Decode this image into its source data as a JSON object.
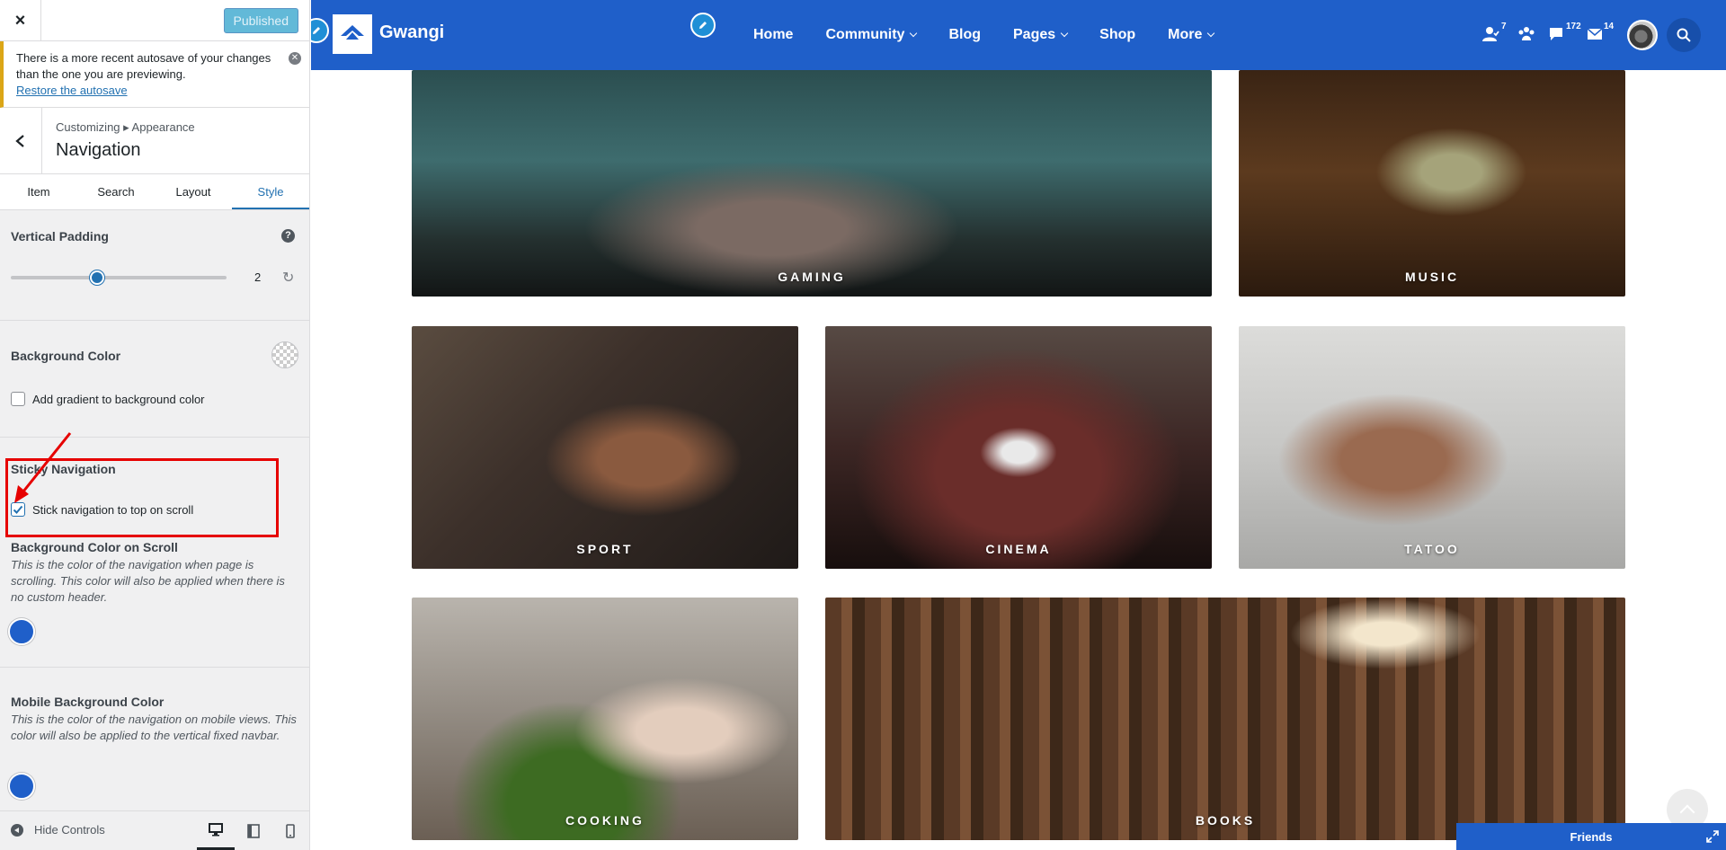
{
  "customizer": {
    "close_label": "×",
    "publish_label": "Published",
    "autosave": {
      "message": "There is a more recent autosave of your changes than the one you are previewing.",
      "link": "Restore the autosave"
    },
    "breadcrumb": "Customizing ▸ Appearance",
    "section_title": "Navigation",
    "tabs": [
      "Item",
      "Search",
      "Layout",
      "Style"
    ],
    "active_tab": "Style",
    "vertical_padding": {
      "label": "Vertical Padding",
      "help": "?",
      "value": "2",
      "slider_fraction": 0.4
    },
    "background_color": {
      "label": "Background Color",
      "gradient_checkbox": "Add gradient to background color",
      "gradient_checked": false
    },
    "sticky": {
      "label": "Sticky Navigation",
      "checkbox": "Stick navigation to top on scroll",
      "checked": true
    },
    "bg_on_scroll": {
      "label": "Background Color on Scroll",
      "description": "This is the color of the navigation when page is scrolling. This color will also be applied when there is no custom header.",
      "color": "#1f5fc9"
    },
    "mobile_bg": {
      "label": "Mobile Background Color",
      "description": "This is the color of the navigation on mobile views. This color will also be applied to the vertical fixed navbar.",
      "color": "#1f5fc9"
    },
    "footer": {
      "hide_controls": "Hide Controls",
      "devices": [
        "desktop-icon",
        "tablet-icon",
        "mobile-icon"
      ],
      "active_device": "desktop-icon"
    }
  },
  "site": {
    "name": "Gwangi",
    "nav_color": "#1f5fc9",
    "menu": [
      {
        "label": "Home",
        "dropdown": false
      },
      {
        "label": "Community",
        "dropdown": true
      },
      {
        "label": "Blog",
        "dropdown": false
      },
      {
        "label": "Pages",
        "dropdown": true
      },
      {
        "label": "Shop",
        "dropdown": false
      },
      {
        "label": "More",
        "dropdown": true
      }
    ],
    "counters": {
      "friends": "7",
      "messages": "172",
      "notifications": "14"
    },
    "tiles": [
      "GAMING",
      "MUSIC",
      "SPORT",
      "CINEMA",
      "TATOO",
      "COOKING",
      "BOOKS"
    ],
    "friends_bar": "Friends"
  }
}
